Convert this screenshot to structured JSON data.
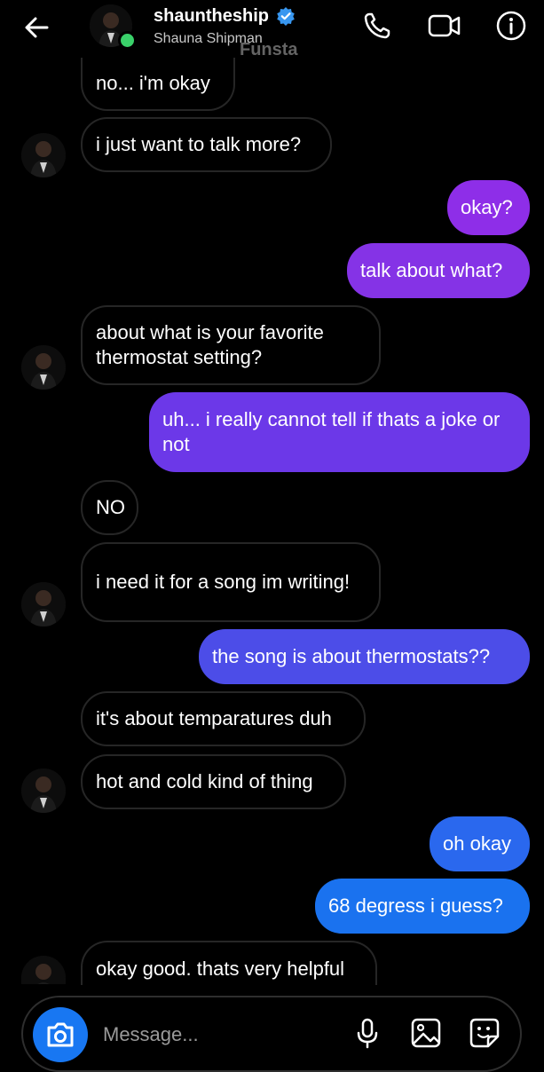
{
  "header": {
    "username": "shauntheship",
    "full_name": "Shauna Shipman",
    "watermark": "Funsta",
    "icons": [
      "back-arrow-icon",
      "verified-badge-icon",
      "phone-icon",
      "video-camera-icon",
      "info-icon"
    ]
  },
  "messages": [
    {
      "side": "received",
      "text": "no... i'm okay"
    },
    {
      "side": "received",
      "text": "i just want to talk more?"
    },
    {
      "side": "sent",
      "text": "okay?"
    },
    {
      "side": "sent",
      "text": "talk about what?"
    },
    {
      "side": "received",
      "text": "about what is your favorite thermostat setting?"
    },
    {
      "side": "sent",
      "text": "uh... i really cannot tell if thats a joke or not"
    },
    {
      "side": "received",
      "text": "NO"
    },
    {
      "side": "received",
      "text": "i need it for a song im writing!"
    },
    {
      "side": "sent",
      "text": "the song is about thermostats??"
    },
    {
      "side": "received",
      "text": "it's about temparatures duh"
    },
    {
      "side": "received",
      "text": "hot and cold kind of thing"
    },
    {
      "side": "sent",
      "text": "oh okay"
    },
    {
      "side": "sent",
      "text": "68 degress i guess?"
    },
    {
      "side": "received",
      "text": "okay good. thats very helpful"
    }
  ],
  "composer": {
    "placeholder": "Message...",
    "icons": [
      "camera-icon",
      "microphone-icon",
      "gallery-icon",
      "sticker-icon"
    ]
  },
  "colors": {
    "background": "#000000",
    "received_border": "#262626",
    "sent_purple": "#8a2be2",
    "sent_blue": "#1877f2",
    "camera_blue": "#1877f2",
    "online": "#3ad16a",
    "verified": "#3897f0"
  }
}
